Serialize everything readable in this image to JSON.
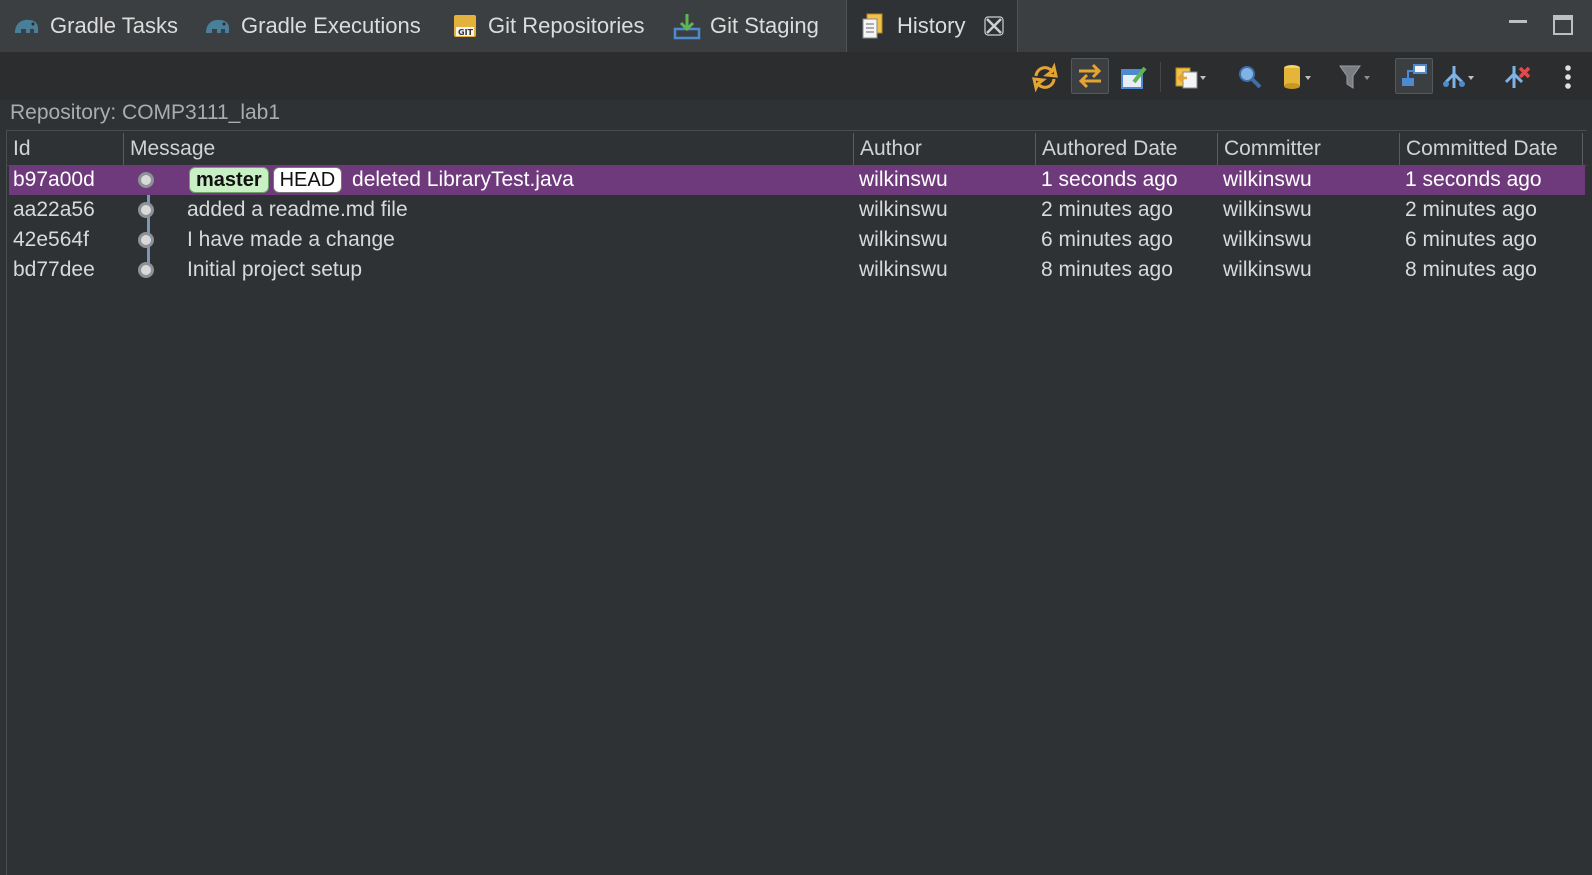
{
  "tabs": [
    {
      "label": "Gradle Tasks",
      "icon": "gradle-elephant-icon"
    },
    {
      "label": "Gradle Executions",
      "icon": "gradle-elephant-icon"
    },
    {
      "label": "Git Repositories",
      "icon": "git-repositories-icon"
    },
    {
      "label": "Git Staging",
      "icon": "git-staging-icon"
    },
    {
      "label": "History",
      "icon": "history-icon",
      "active": true
    }
  ],
  "repository_label": "Repository: COMP3111_lab1",
  "columns": [
    "Id",
    "Message",
    "Author",
    "Authored Date",
    "Committer",
    "Committed Date"
  ],
  "commits": [
    {
      "id": "b97a00d",
      "refs": [
        "master",
        "HEAD"
      ],
      "message": "deleted LibraryTest.java",
      "author": "wilkinswu",
      "authored": "1 seconds ago",
      "committer": "wilkinswu",
      "committed": "1 seconds ago",
      "selected": true
    },
    {
      "id": "aa22a56",
      "refs": [],
      "message": "added a readme.md file",
      "author": "wilkinswu",
      "authored": "2 minutes ago",
      "committer": "wilkinswu",
      "committed": "2 minutes ago"
    },
    {
      "id": "42e564f",
      "refs": [],
      "message": "I have made a change",
      "author": "wilkinswu",
      "authored": "6 minutes ago",
      "committer": "wilkinswu",
      "committed": "6 minutes ago"
    },
    {
      "id": "bd77dee",
      "refs": [],
      "message": "Initial project setup",
      "author": "wilkinswu",
      "authored": "8 minutes ago",
      "committer": "wilkinswu",
      "committed": "8 minutes ago"
    }
  ],
  "colors": {
    "selection": "#6f3a7c",
    "background": "#2f3234",
    "branch_badge": "#c9efc4"
  }
}
